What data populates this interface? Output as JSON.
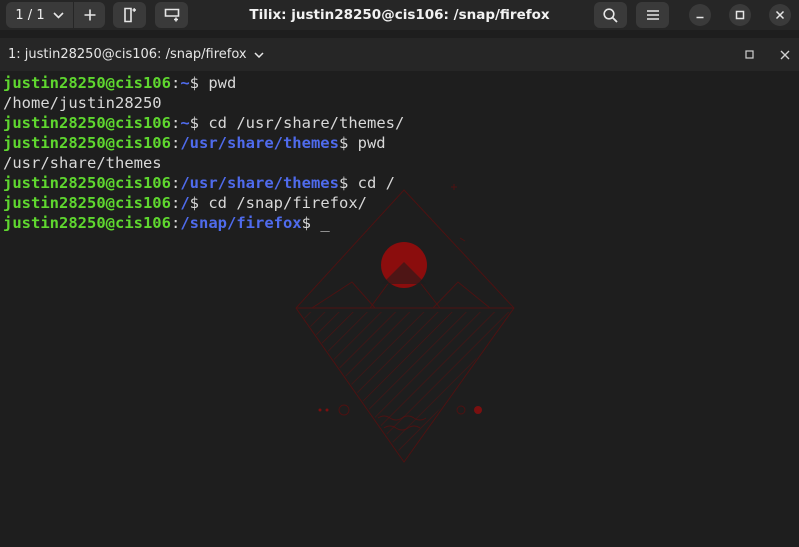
{
  "titlebar": {
    "session_indicator": "1 / 1",
    "title": "Tilix: justin28250@cis106: /snap/firefox"
  },
  "tab": {
    "label": "1: justin28250@cis106: /snap/firefox"
  },
  "terminal": {
    "colors": {
      "user": "#5fd72f",
      "path": "#4f6bec",
      "text": "#d8d8d8",
      "background": "#1e1e1e",
      "wallpaper_accent": "#8b0d0d"
    },
    "lines": [
      {
        "user": "justin28250@cis106",
        "path": "~",
        "command": "pwd"
      },
      {
        "output": "/home/justin28250"
      },
      {
        "user": "justin28250@cis106",
        "path": "~",
        "command": "cd /usr/share/themes/"
      },
      {
        "user": "justin28250@cis106",
        "path": "/usr/share/themes",
        "command": "pwd"
      },
      {
        "output": "/usr/share/themes"
      },
      {
        "user": "justin28250@cis106",
        "path": "/usr/share/themes",
        "command": "cd /"
      },
      {
        "user": "justin28250@cis106",
        "path": "/",
        "command": "cd /snap/firefox/"
      },
      {
        "user": "justin28250@cis106",
        "path": "/snap/firefox",
        "command": "",
        "cursor": "_"
      }
    ]
  }
}
